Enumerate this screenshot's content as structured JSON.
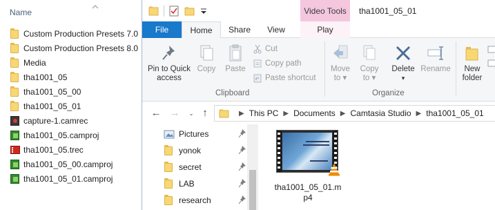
{
  "background_window": {
    "column_header": "Name",
    "files": [
      {
        "name": "Custom Production Presets 7.0",
        "icon": "folder-icon"
      },
      {
        "name": "Custom Production Presets 8.0",
        "icon": "folder-icon"
      },
      {
        "name": "Media",
        "icon": "folder-icon"
      },
      {
        "name": "tha1001_05",
        "icon": "folder-icon"
      },
      {
        "name": "tha1001_05_00",
        "icon": "folder-icon"
      },
      {
        "name": "tha1001_05_01",
        "icon": "folder-icon"
      },
      {
        "name": "capture-1.camrec",
        "icon": "camrec-icon"
      },
      {
        "name": "tha1001_05.camproj",
        "icon": "camproj-icon"
      },
      {
        "name": "tha1001_05.trec",
        "icon": "trec-icon"
      },
      {
        "name": "tha1001_05_00.camproj",
        "icon": "camproj-icon"
      },
      {
        "name": "tha1001_05_01.camproj",
        "icon": "camproj-icon"
      }
    ]
  },
  "window": {
    "title": "tha1001_05_01",
    "contextual_tab_group": "Video Tools"
  },
  "tabs": {
    "file": "File",
    "home": "Home",
    "share": "Share",
    "view": "View",
    "play": "Play"
  },
  "ribbon": {
    "clipboard": {
      "group_label": "Clipboard",
      "pin_label_1": "Pin to Quick",
      "pin_label_2": "access",
      "copy": "Copy",
      "paste": "Paste",
      "cut": "Cut",
      "copy_path": "Copy path",
      "paste_shortcut": "Paste shortcut"
    },
    "organize": {
      "group_label": "Organize",
      "move_to_1": "Move",
      "move_to_2": "to",
      "copy_to_1": "Copy",
      "copy_to_2": "to",
      "delete": "Delete",
      "rename": "Rename"
    },
    "new": {
      "new_folder_1": "New",
      "new_folder_2": "folder"
    }
  },
  "address": {
    "crumbs": [
      "This PC",
      "Documents",
      "Camtasia Studio",
      "tha1001_05_01"
    ]
  },
  "nav_pane": {
    "items": [
      {
        "label": "Pictures",
        "icon": "pictures-icon"
      },
      {
        "label": "yonok",
        "icon": "folder-icon"
      },
      {
        "label": "secret",
        "icon": "folder-icon"
      },
      {
        "label": "LAB",
        "icon": "folder-icon"
      },
      {
        "label": "research",
        "icon": "folder-icon"
      }
    ]
  },
  "file_view": {
    "items": [
      {
        "name": "tha1001_05_01.mp4",
        "icon": "vlc-video-icon"
      }
    ]
  }
}
